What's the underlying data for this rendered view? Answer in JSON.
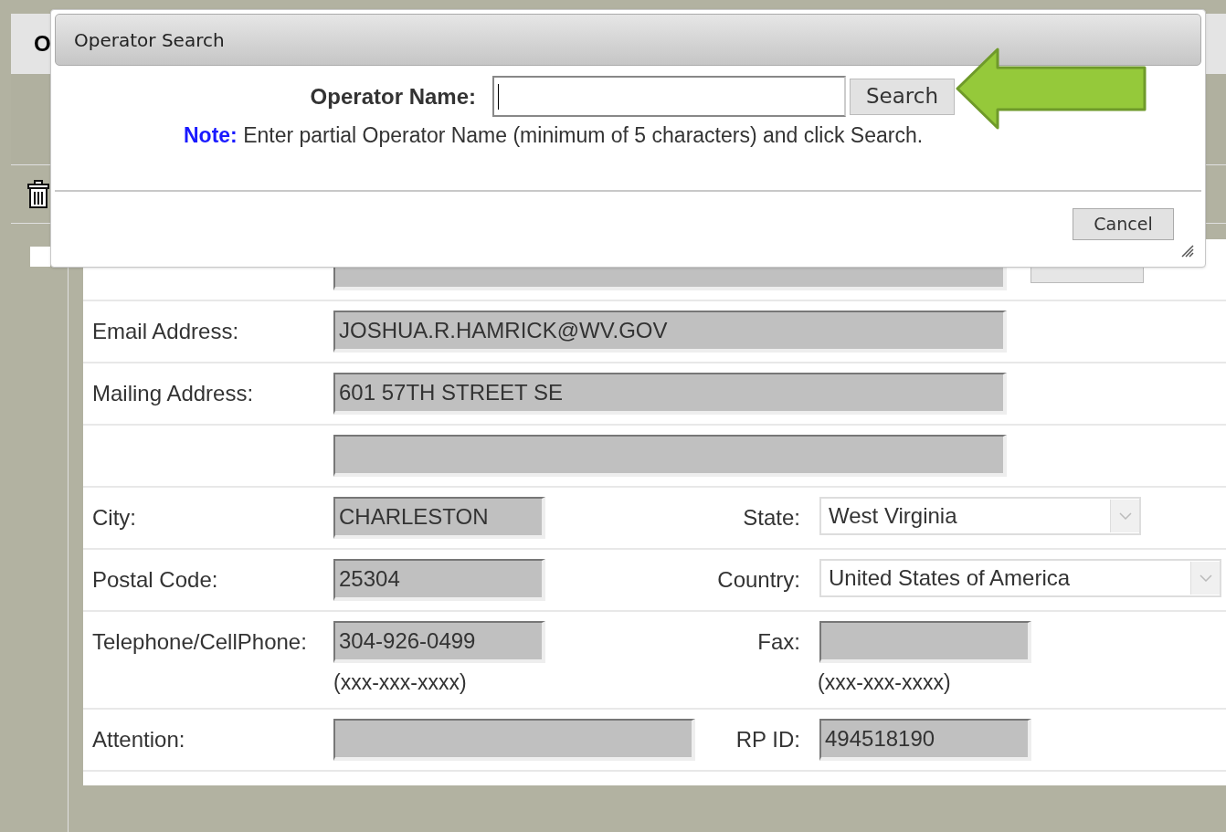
{
  "page": {
    "heading": "O",
    "checkbox": {
      "checked": false
    }
  },
  "form": {
    "rows": [
      {
        "kind": "long",
        "button": true
      },
      {
        "kind": "long",
        "label": "Email Address:",
        "value": "JOSHUA.R.HAMRICK@WV.GOV"
      },
      {
        "kind": "long",
        "label": "Mailing Address:",
        "value": "601 57TH STREET SE"
      },
      {
        "kind": "long"
      },
      {
        "kind": "short",
        "label": "City:",
        "value": "CHARLESTON",
        "right": {
          "kind": "select",
          "label": "State:",
          "value": "West Virginia"
        }
      },
      {
        "kind": "short",
        "label": "Postal Code:",
        "value": "25304",
        "right": {
          "kind": "select",
          "label": "Country:",
          "value": "United States of America"
        }
      },
      {
        "kind": "short",
        "label": "Telephone/CellPhone:",
        "value": "304-926-0499",
        "hint": "(xxx-xxx-xxxx)",
        "right": {
          "kind": "input",
          "label": "Fax:",
          "hint": "(xxx-xxx-xxxx)"
        }
      },
      {
        "kind": "medium",
        "label": "Attention:",
        "right": {
          "kind": "input",
          "label": "RP ID:",
          "value": "494518190"
        }
      }
    ]
  },
  "dialog": {
    "title": "Operator Search",
    "field_label": "Operator Name:",
    "note": "**Note:** Enter partial Operator Name (minimum of 5 characters) and click Search.",
    "search_button": "Search",
    "cancel_button": "Cancel"
  }
}
